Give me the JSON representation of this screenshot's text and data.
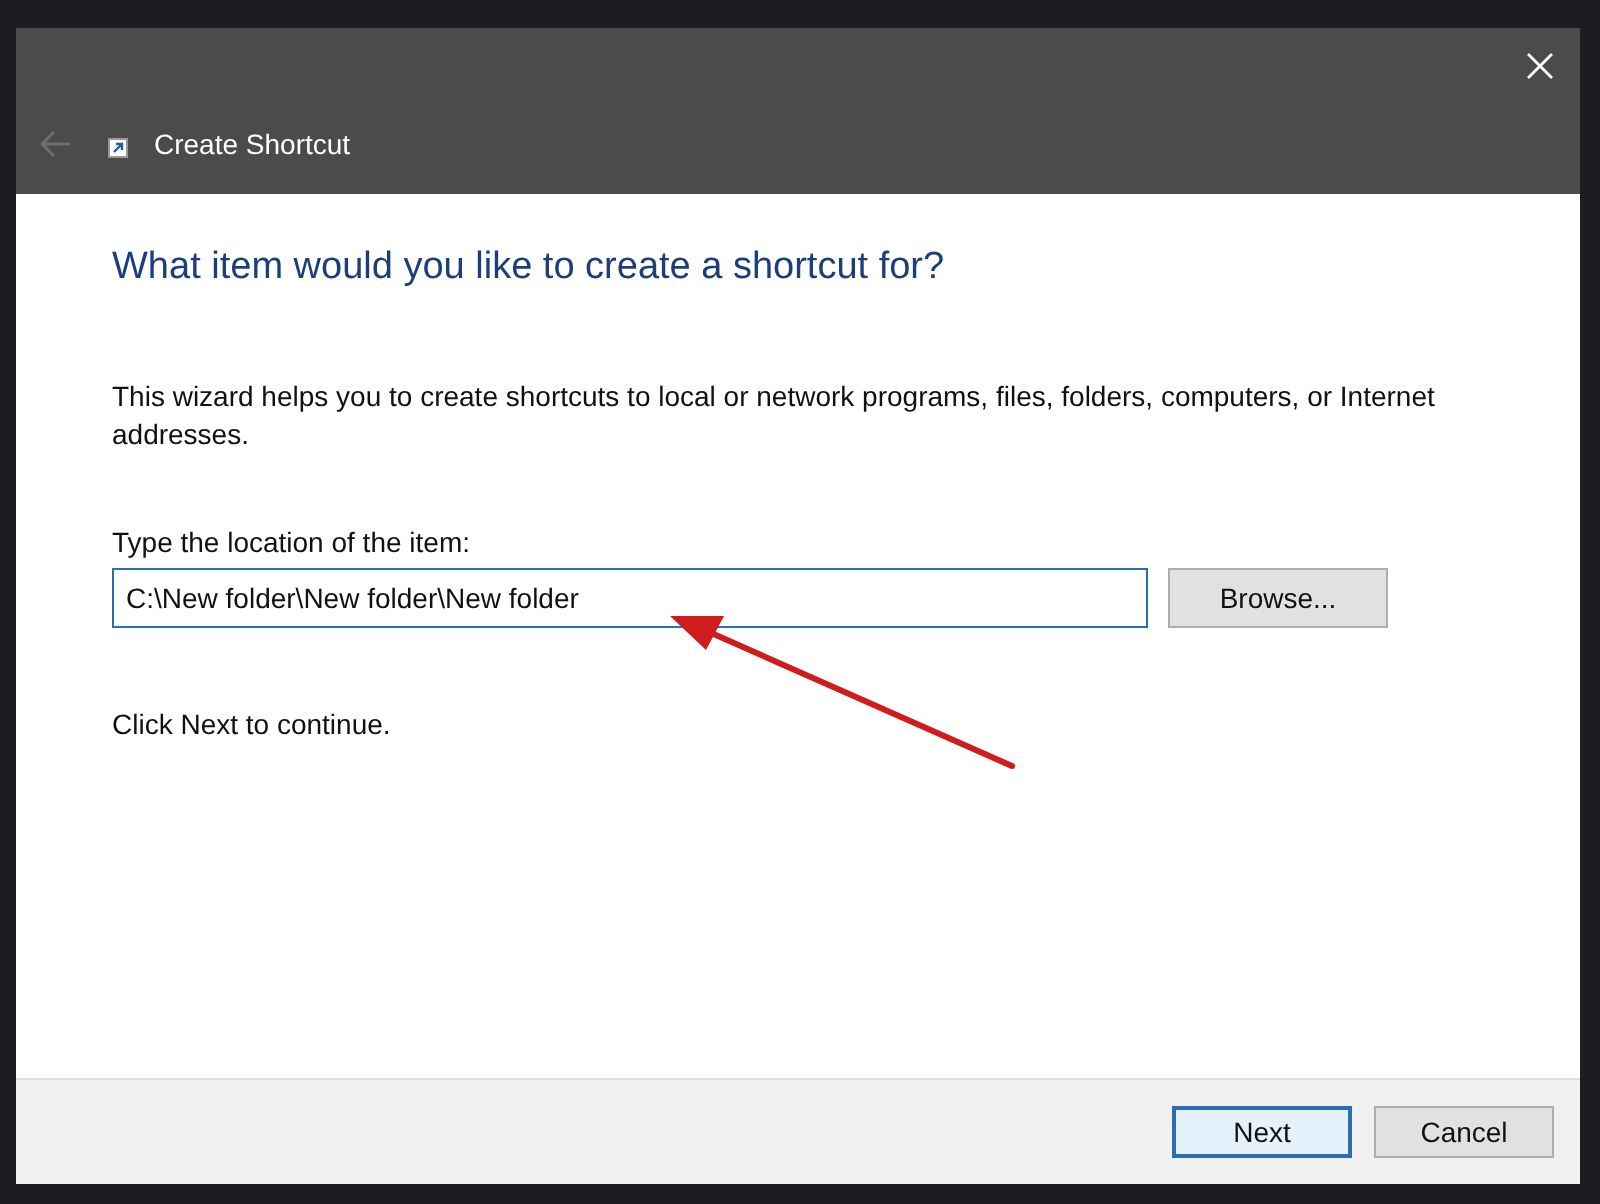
{
  "window": {
    "title": "Create Shortcut",
    "back_disabled": true
  },
  "heading": "What item would you like to create a shortcut for?",
  "description": "This wizard helps you to create shortcuts to local or network programs, files, folders, computers, or Internet addresses.",
  "location": {
    "label": "Type the location of the item:",
    "value": "C:\\New folder\\New folder\\New folder",
    "focused": true
  },
  "browse_button": "Browse...",
  "hint": "Click Next to continue.",
  "buttons": [
    {
      "label": "Next",
      "default": true
    },
    {
      "label": "Cancel",
      "default": false
    }
  ]
}
